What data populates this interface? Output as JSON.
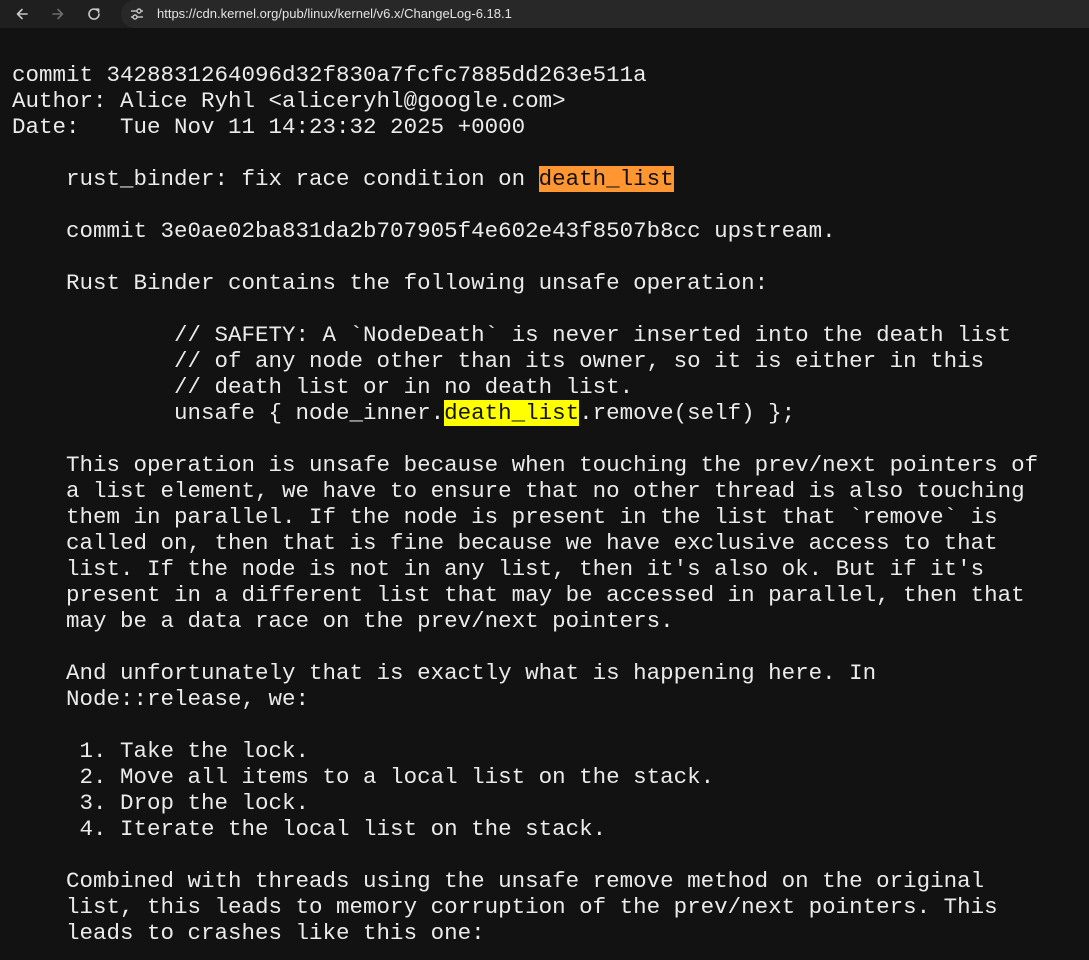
{
  "browser": {
    "back_icon": "arrow-left-icon",
    "forward_icon": "arrow-right-icon",
    "reload_icon": "reload-icon",
    "site_info_icon": "tune-icon",
    "url": "https://cdn.kernel.org/pub/linux/kernel/v6.x/ChangeLog-6.18.1"
  },
  "colors": {
    "background": "#121212",
    "text": "#ebebeb",
    "highlight_active": "#ff9632",
    "highlight_match": "#ffff00"
  },
  "changelog": {
    "commit_line": "commit 3428831264096d32f830a7fcfc7885dd263e511a",
    "author_line": "Author: Alice Ryhl <aliceryhl@google.com>",
    "date_line": "Date:   Tue Nov 11 14:23:32 2025 +0000",
    "subject_prefix": "    rust_binder: fix race condition on ",
    "subject_highlight": "death_list",
    "upstream_line": "    commit 3e0ae02ba831da2b707905f4e602e43f8507b8cc upstream.",
    "intro_line": "    Rust Binder contains the following unsafe operation:",
    "code_1": "            // SAFETY: A `NodeDeath` is never inserted into the death list",
    "code_2": "            // of any node other than its owner, so it is either in this",
    "code_3": "            // death list or in no death list.",
    "code_4_prefix": "            unsafe { node_inner.",
    "code_4_highlight": "death_list",
    "code_4_suffix": ".remove(self) };",
    "para1": [
      "    This operation is unsafe because when touching the prev/next pointers of",
      "    a list element, we have to ensure that no other thread is also touching",
      "    them in parallel. If the node is present in the list that `remove` is",
      "    called on, then that is fine because we have exclusive access to that",
      "    list. If the node is not in any list, then it's also ok. But if it's",
      "    present in a different list that may be accessed in parallel, then that",
      "    may be a data race on the prev/next pointers."
    ],
    "para2": [
      "    And unfortunately that is exactly what is happening here. In",
      "    Node::release, we:"
    ],
    "steps": [
      "     1. Take the lock.",
      "     2. Move all items to a local list on the stack.",
      "     3. Drop the lock.",
      "     4. Iterate the local list on the stack."
    ],
    "para3": [
      "    Combined with threads using the unsafe remove method on the original",
      "    list, this leads to memory corruption of the prev/next pointers. This",
      "    leads to crashes like this one:"
    ]
  }
}
